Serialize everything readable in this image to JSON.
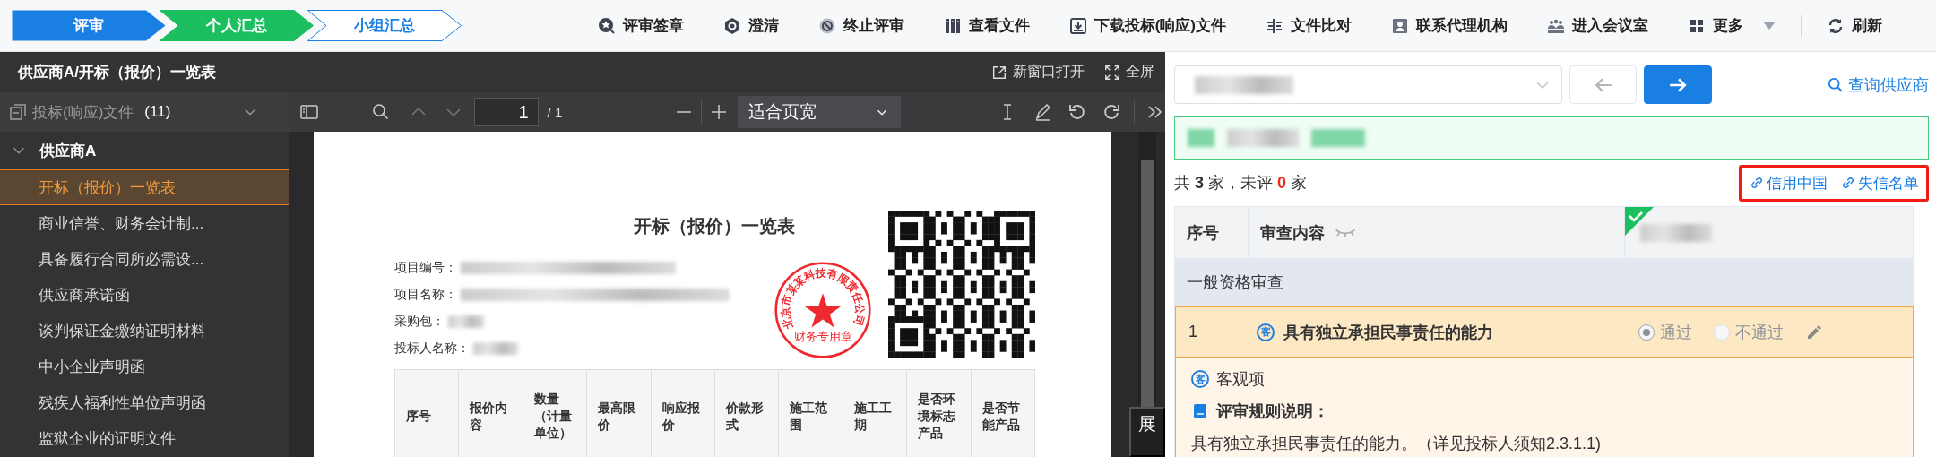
{
  "steps": [
    {
      "label": "评审",
      "selected": true,
      "completed": false
    },
    {
      "label": "个人汇总",
      "selected": false,
      "completed": true
    },
    {
      "label": "小组汇总",
      "selected": false,
      "completed": false
    }
  ],
  "toolbar": {
    "items": [
      {
        "label": "评审签章",
        "has_menu": false
      },
      {
        "label": "澄清",
        "has_menu": false
      },
      {
        "label": "终止评审",
        "has_menu": false
      },
      {
        "label": "查看文件",
        "has_menu": false
      },
      {
        "label": "下载投标(响应)文件",
        "has_menu": false
      },
      {
        "label": "文件比对",
        "has_menu": false
      },
      {
        "label": "联系代理机构",
        "has_menu": false
      },
      {
        "label": "进入会议室",
        "has_menu": false
      },
      {
        "label": "更多",
        "has_menu": true
      }
    ],
    "end_items": [
      {
        "label": "刷新",
        "has_menu": false
      }
    ]
  },
  "document_panel": {
    "title": "供应商A/开标（报价）一览表",
    "actions": [
      {
        "label": "新窗口打开"
      },
      {
        "label": "全屏"
      }
    ]
  },
  "file_tree": {
    "header": {
      "label": "投标(响应)文件",
      "count": "(11)"
    },
    "groups": [
      {
        "label": "供应商A",
        "expanded": true,
        "children": [
          {
            "label": "开标（报价）一览表",
            "selected": true
          },
          {
            "label": "商业信誉、财务会计制...",
            "selected": false
          },
          {
            "label": "具备履行合同所必需设...",
            "selected": false
          },
          {
            "label": "供应商承诺函",
            "selected": false
          },
          {
            "label": "谈判保证金缴纳证明材料",
            "selected": false
          },
          {
            "label": "中小企业声明函",
            "selected": false
          },
          {
            "label": "残疾人福利性单位声明函",
            "selected": false
          },
          {
            "label": "监狱企业的证明文件",
            "selected": false
          }
        ]
      }
    ]
  },
  "pdf_viewer": {
    "page": "1",
    "total": "/ 1",
    "zoom": "适合页宽",
    "side_tab": "展",
    "document": {
      "title": "开标（报价）一览表",
      "fields": [
        {
          "label": "项目编号："
        },
        {
          "label": "项目名称："
        },
        {
          "label": "采购包："
        },
        {
          "label": "投标人名称："
        }
      ],
      "table": {
        "columns": [
          "序号",
          "报价内容",
          "数量（计量单位）",
          "最高限价",
          "响应报价",
          "价款形式",
          "施工范围",
          "施工工期",
          "是否环境标志产品",
          "是否节能产品"
        ]
      },
      "stamp": {
        "ring_text": "北京市某某科技有限责任公司",
        "center_text": "财务专用章"
      }
    }
  },
  "review_panel": {
    "search_link": "查询供应商",
    "summary": {
      "prefix": "共",
      "total": "3",
      "middle": "家，未评",
      "unrated": "0",
      "suffix": "家"
    },
    "links": [
      {
        "label": "信用中国"
      },
      {
        "label": "失信名单"
      }
    ],
    "table": {
      "columns": [
        "序号",
        "审查内容"
      ],
      "supplier_column": {
        "reviewed": true
      },
      "sections": [
        {
          "title": "一般资格审查",
          "items": [
            {
              "index": "1",
              "tag": "客",
              "title": "具有独立承担民事责任的能力",
              "disabled": true,
              "expanded": true,
              "options": [
                {
                  "label": "通过",
                  "selected": true
                },
                {
                  "label": "不通过",
                  "selected": false
                }
              ],
              "detail": {
                "tag": "客",
                "type_label": "客观项",
                "rule_title": "评审规则说明：",
                "rule_text": "具有独立承担民事责任的能力。（详见投标人须知2.3.1.1)"
              }
            }
          ]
        }
      ]
    }
  }
}
